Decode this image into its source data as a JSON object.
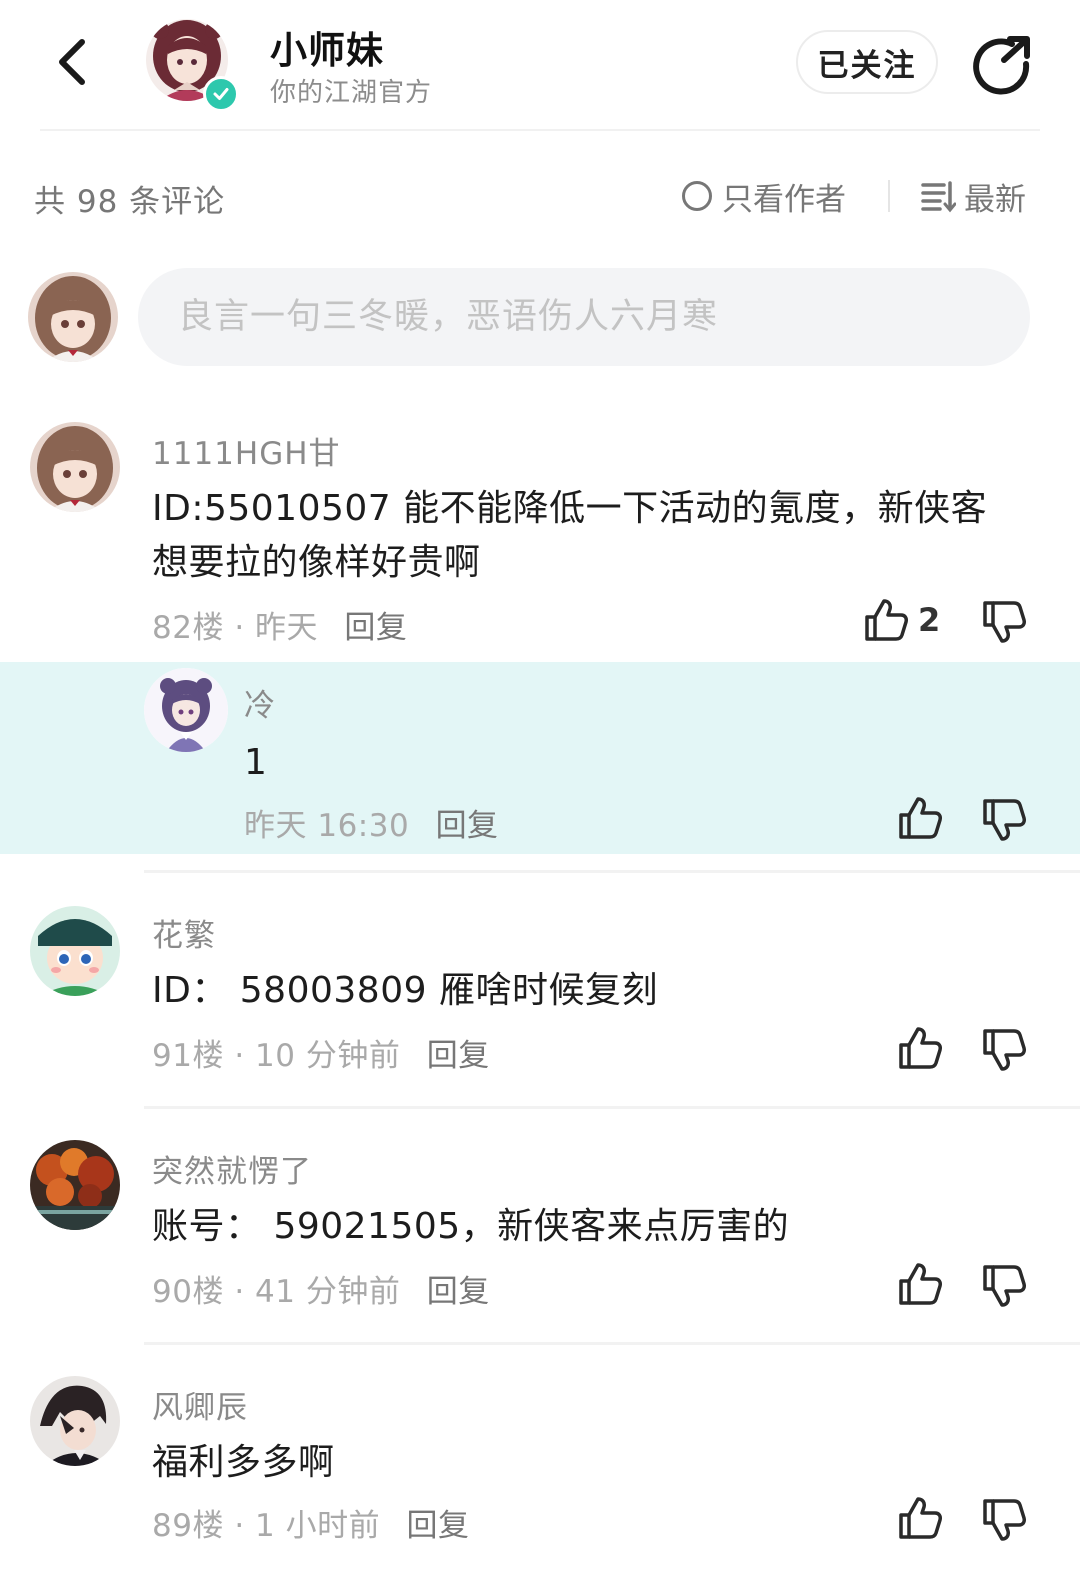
{
  "header": {
    "author_name": "小师妹",
    "author_subtitle": "你的江湖官方",
    "follow_label": "已关注",
    "icons": {
      "back": "chevron-left-icon",
      "share": "share-icon",
      "verified": "verified-check-icon"
    }
  },
  "comments_bar": {
    "count_label": "共 98 条评论",
    "only_author_label": "只看作者",
    "sort_label": "最新"
  },
  "input": {
    "placeholder": "良言一句三冬暖，恶语伤人六月寒"
  },
  "comments": [
    {
      "username": "1111HGH甘",
      "text_line1": "ID:55010507 能不能降低一下活动的氪度，新侠客",
      "text_line2": "想要拉的像样好贵啊",
      "floor": "82楼",
      "time": "昨天",
      "reply_label": "回复",
      "likes": "2",
      "reply": {
        "username": "冷",
        "text": "1",
        "time": "昨天 16:30",
        "reply_label": "回复"
      }
    },
    {
      "username": "花繁",
      "text": "ID：  58003809 雁啥时候复刻",
      "floor": "91楼",
      "time": "10 分钟前",
      "reply_label": "回复"
    },
    {
      "username": "突然就愣了",
      "text": "账号：  59021505，新侠客来点厉害的",
      "floor": "90楼",
      "time": "41 分钟前",
      "reply_label": "回复"
    },
    {
      "username": "风卿辰",
      "text": "福利多多啊",
      "floor": "89楼",
      "time": "1 小时前",
      "reply_label": "回复"
    }
  ],
  "colors": {
    "reply_highlight_bg": "#e3f6f6",
    "verified_badge": "#2dc8ad",
    "input_bg": "#f3f4f6",
    "meta_text": "#a9a9a9"
  }
}
